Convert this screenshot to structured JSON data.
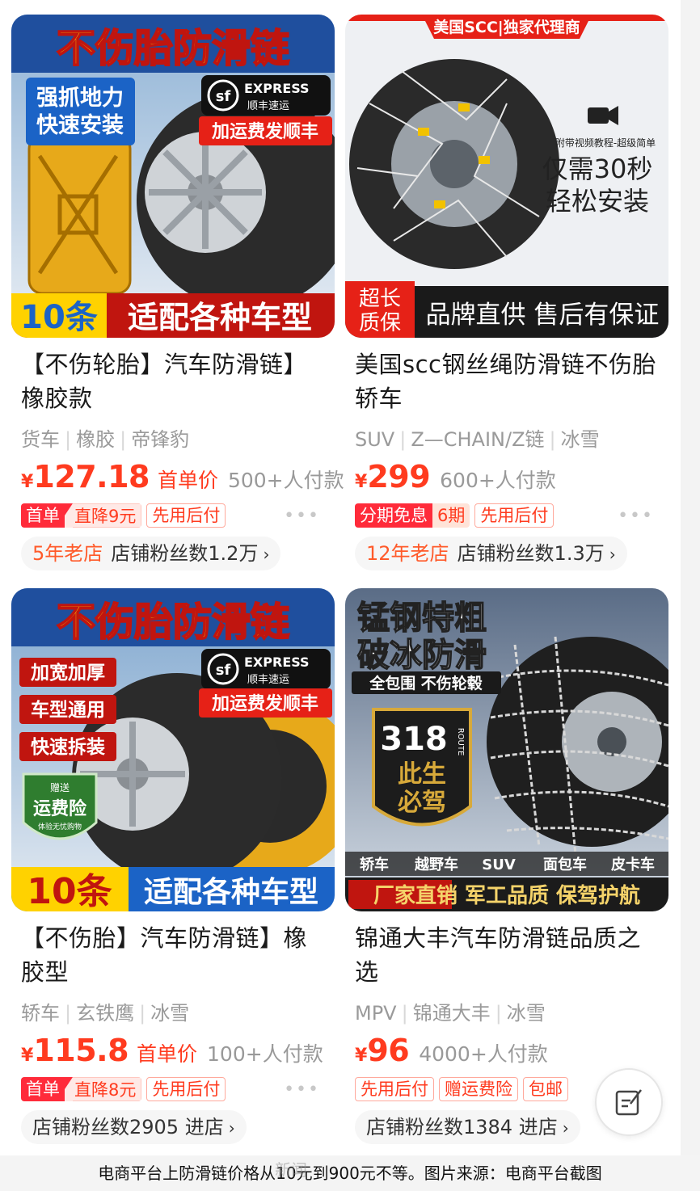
{
  "products": [
    {
      "image": {
        "banner_top": "不伤胎防滑链",
        "side_lines": [
          "强抓地力",
          "快速安装"
        ],
        "express_en": "EXPRESS",
        "express_logo": "sf",
        "express_cn": "顺丰速运",
        "shipping_note": "加运费发顺丰",
        "count_label": "10条",
        "fit_label": "适配各种车型"
      },
      "title": "【不伤轮胎】汽车防滑链】橡胶款",
      "tags": [
        "货车",
        "橡胶",
        "帝锋豹"
      ],
      "currency": "¥",
      "price": "127.18",
      "price_note": "首单价",
      "sales": "500+人付款",
      "badge_pair": {
        "left": "首单",
        "right": "直降9元"
      },
      "badges": [
        "先用后付"
      ],
      "more": "•••",
      "shop": {
        "age": "5年老店",
        "fans": "店铺粉丝数1.2万",
        "chevron": "›"
      }
    },
    {
      "image": {
        "ribbon": "美国SCC|独家代理商",
        "video_line": "附带视频教程-超级简单",
        "install_lines": [
          "仅需30秒",
          "轻松安装"
        ],
        "corner_lines": [
          "超长",
          "质保"
        ],
        "bottom_label": "品牌直供 售后有保证"
      },
      "title": "美国scc钢丝绳防滑链不伤胎轿车",
      "tags": [
        "SUV",
        "Z—CHAIN/Z链",
        "冰雪"
      ],
      "currency": "¥",
      "price": "299",
      "price_note": "",
      "sales": "600+人付款",
      "badge_pair": {
        "left": "分期免息",
        "right": "6期"
      },
      "badges": [
        "先用后付"
      ],
      "more": "•••",
      "shop": {
        "age": "12年老店",
        "fans": "店铺粉丝数1.3万",
        "chevron": "›"
      }
    },
    {
      "image": {
        "banner_top": "不伤胎防滑链",
        "side_lines": [
          "加宽加厚",
          "车型通用",
          "快速拆装"
        ],
        "shield_top": "赠送",
        "shield_main": "运费险",
        "shield_sub": "体验无忧购物",
        "express_en": "EXPRESS",
        "express_logo": "sf",
        "express_cn": "顺丰速运",
        "shipping_note": "加运费发顺丰",
        "count_label": "10条",
        "fit_label": "适配各种车型"
      },
      "title": "【不伤胎】汽车防滑链】橡胶型",
      "tags": [
        "轿车",
        "玄铁鹰",
        "冰雪"
      ],
      "currency": "¥",
      "price": "115.8",
      "price_note": "首单价",
      "sales": "100+人付款",
      "badge_pair": {
        "left": "首单",
        "right": "直降8元"
      },
      "badges": [
        "先用后付"
      ],
      "more": "•••",
      "shop": {
        "age": "",
        "fans": "店铺粉丝数2905",
        "enter": "进店",
        "chevron": "›"
      }
    },
    {
      "image": {
        "headline_lines": [
          "锰钢特粗",
          "破冰防滑"
        ],
        "sub_label": "全包围 不伤轮毂",
        "route_num": "318",
        "route_word": "ROUTE",
        "route_lines": [
          "此生",
          "必驾"
        ],
        "vehicle_types": [
          "轿车",
          "越野车",
          "SUV",
          "面包车",
          "皮卡车"
        ],
        "bottom_label": "厂家直销 军工品质 保驾护航"
      },
      "title": "锦通大丰汽车防滑链品质之选",
      "tags": [
        "MPV",
        "锦通大丰",
        "冰雪"
      ],
      "currency": "¥",
      "price": "96",
      "price_note": "",
      "sales": "4000+人付款",
      "badges": [
        "先用后付",
        "赠运费险",
        "包邮"
      ],
      "more": "",
      "shop": {
        "age": "",
        "fans": "店铺粉丝数1384",
        "enter": "进店",
        "chevron": "›"
      }
    }
  ],
  "caption": "电商平台上防滑链价格从10元到900元不等。图片来源：电商平台截图",
  "watermark": "新闻",
  "colors": {
    "price_red": "#ff3b1f",
    "badge_red": "#ff2b3a",
    "shop_age_orange": "#ff5a2a",
    "tag_grey": "#9a9a9a"
  },
  "icons": {
    "edit": "edit-icon",
    "video": "video-icon"
  }
}
